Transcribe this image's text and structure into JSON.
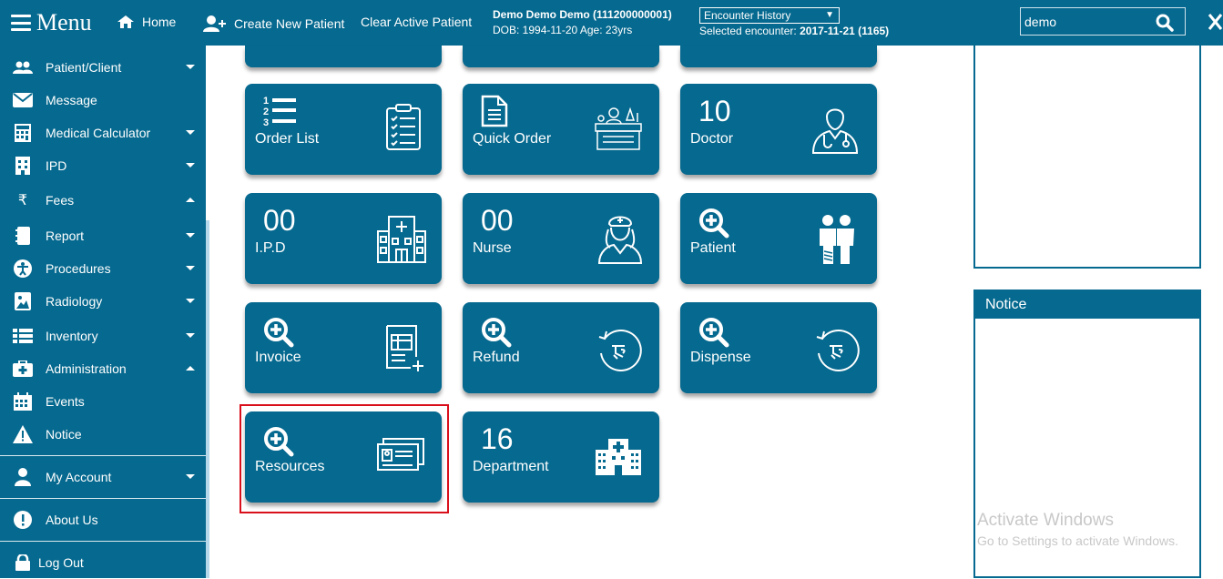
{
  "header": {
    "menu_label": "Menu",
    "home_label": "Home",
    "create_patient_label": "Create New Patient",
    "clear_patient_label": "Clear Active Patient",
    "patient_name": "Demo Demo Demo (111200000001)",
    "patient_dob": "DOB: 1994-11-20 Age: 23yrs",
    "encounter_select": "Encounter History",
    "encounter_prefix": "Selected encounter:",
    "encounter_value": "2017-11-21 (1165)",
    "search_value": "demo"
  },
  "sidebar": {
    "items": [
      {
        "label": "Patient/Client",
        "icon": "users-icon",
        "caret": "down"
      },
      {
        "label": "Message",
        "icon": "envelope-icon",
        "caret": "none"
      },
      {
        "label": "Medical Calculator",
        "icon": "calculator-icon",
        "caret": "down"
      },
      {
        "label": "IPD",
        "icon": "hospital-building-icon",
        "caret": "down"
      },
      {
        "label": "Fees",
        "icon": "rupee-icon",
        "caret": "up"
      },
      {
        "label": "Report",
        "icon": "book-icon",
        "caret": "down"
      },
      {
        "label": "Procedures",
        "icon": "universal-access-icon",
        "caret": "down"
      },
      {
        "label": "Radiology",
        "icon": "image-icon",
        "caret": "down"
      },
      {
        "label": "Inventory",
        "icon": "list-icon",
        "caret": "down"
      },
      {
        "label": "Administration",
        "icon": "medkit-icon",
        "caret": "up"
      },
      {
        "label": "Events",
        "icon": "calendar-icon",
        "caret": "none"
      },
      {
        "label": "Notice",
        "icon": "warning-icon",
        "caret": "none"
      },
      {
        "label": "My Account",
        "icon": "user-icon",
        "caret": "down"
      },
      {
        "label": "About Us",
        "icon": "info-icon",
        "caret": "none"
      },
      {
        "label": "Log Out",
        "icon": "lock-icon",
        "caret": "none"
      }
    ]
  },
  "tiles": [
    {
      "title": "Order List",
      "number": "",
      "left_icon": "numbered-list-icon",
      "right_icon": "clipboard-checklist-icon"
    },
    {
      "title": "Quick Order",
      "number": "",
      "left_icon": "document-icon",
      "right_icon": "lab-technician-icon"
    },
    {
      "title": "Doctor",
      "number": "10",
      "left_icon": "",
      "right_icon": "doctor-icon"
    },
    {
      "title": "I.P.D",
      "number": "00",
      "left_icon": "",
      "right_icon": "hospital-icon"
    },
    {
      "title": "Nurse",
      "number": "00",
      "left_icon": "",
      "right_icon": "nurse-icon"
    },
    {
      "title": "Patient",
      "number": "",
      "left_icon": "zoom-in-icon",
      "right_icon": "patients-icon"
    },
    {
      "title": "Invoice",
      "number": "",
      "left_icon": "zoom-in-icon",
      "right_icon": "invoice-icon"
    },
    {
      "title": "Refund",
      "number": "",
      "left_icon": "zoom-in-icon",
      "right_icon": "refund-icon"
    },
    {
      "title": "Dispense",
      "number": "",
      "left_icon": "zoom-in-icon",
      "right_icon": "dispense-icon"
    },
    {
      "title": "Resources",
      "number": "",
      "left_icon": "zoom-in-icon",
      "right_icon": "id-cards-icon"
    },
    {
      "title": "Department",
      "number": "16",
      "left_icon": "",
      "right_icon": "hospital-department-icon"
    }
  ],
  "notice_panel": {
    "title": "Notice"
  },
  "watermark": {
    "line1": "Activate Windows",
    "line2": "Go to Settings to activate Windows."
  }
}
